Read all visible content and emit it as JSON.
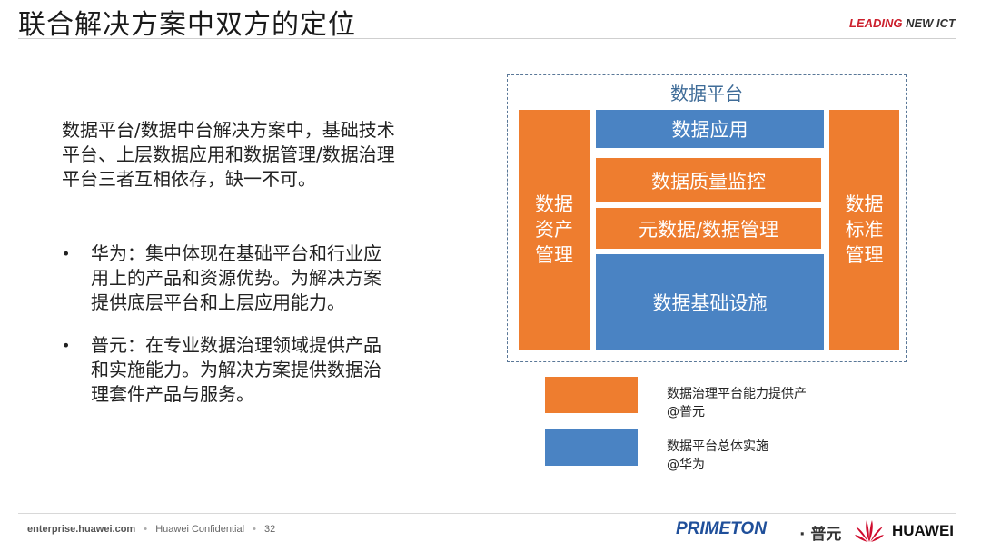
{
  "header": {
    "title": "联合解决方案中双方的定位",
    "brand_red": "LEADING",
    "brand_dark": " NEW ICT"
  },
  "body": {
    "intro": "数据平台/数据中台解决方案中，基础技术平台、上层数据应用和数据管理/数据治理平台三者互相依存，缺一不可。",
    "bullets": [
      {
        "marker": "•",
        "text": "华为：集中体现在基础平台和行业应用上的产品和资源优势。为解决方案提供底层平台和上层应用能力。"
      },
      {
        "marker": "•",
        "text": "普元：在专业数据治理领域提供产品和实施能力。为解决方案提供数据治理套件产品与服务。"
      }
    ]
  },
  "diagram": {
    "title": "数据平台",
    "left_column": [
      "数据",
      "资产",
      "管理"
    ],
    "right_column": [
      "数据",
      "标准",
      "管理"
    ],
    "blocks": {
      "app": "数据应用",
      "quality": "数据质量监控",
      "metadata": "元数据/数据管理",
      "infra": "数据基础设施"
    },
    "colors": {
      "orange": "#ee7d2f",
      "blue": "#4a83c3",
      "border": "#5a7898"
    }
  },
  "legend": [
    {
      "color": "#ee7d2f",
      "line1": "数据治理平台能力提供产",
      "line2": "@普元"
    },
    {
      "color": "#4a83c3",
      "line1": "数据平台总体实施",
      "line2": "@华为"
    }
  ],
  "footer": {
    "site": "enterprise.huawei.com",
    "confidential": "Huawei Confidential",
    "page": "32",
    "partner_logo": "PRIMETON",
    "partner_cn": "· 普元",
    "huawei": "HUAWEI"
  }
}
